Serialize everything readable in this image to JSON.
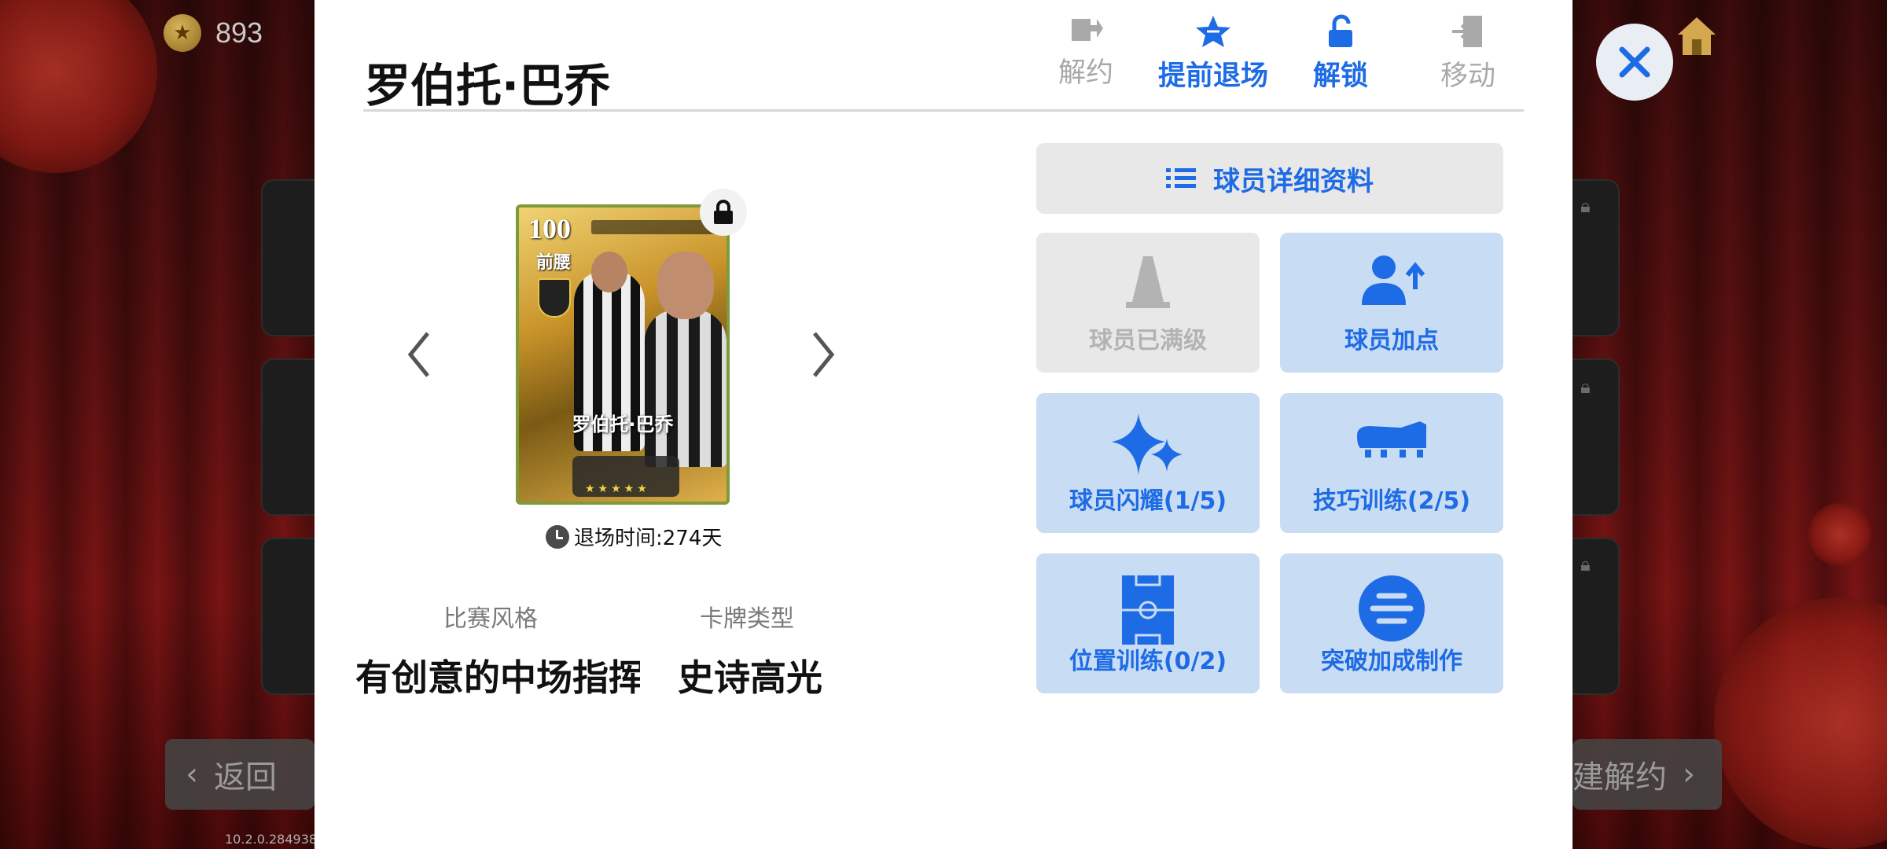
{
  "currency": {
    "amount": "893",
    "icon": "coin-star-icon"
  },
  "background": {
    "back_button_label": "返回",
    "bulk_button_label": "建解约",
    "version": "10.2.0.284938"
  },
  "player": {
    "name": "罗伯托·巴乔",
    "card": {
      "rating": "100",
      "position": "前腰",
      "name": "罗伯托·巴乔"
    },
    "retire_time": "退场时间:274天",
    "play_style_label": "比赛风格",
    "play_style_value": "有创意的中场指挥",
    "card_type_label": "卡牌类型",
    "card_type_value": "史诗高光"
  },
  "top_actions": [
    {
      "label": "解约",
      "icon": "terminate-contract-icon",
      "state": "disabled"
    },
    {
      "label": "提前退场",
      "icon": "early-retire-star-icon",
      "state": "active"
    },
    {
      "label": "解锁",
      "icon": "unlock-icon",
      "state": "active"
    },
    {
      "label": "移动",
      "icon": "move-door-icon",
      "state": "disabled"
    }
  ],
  "detail_button": {
    "label": "球员详细资料",
    "icon": "list-icon"
  },
  "tiles": [
    {
      "label": "球员已满级",
      "icon": "training-cone-icon",
      "state": "off"
    },
    {
      "label": "球员加点",
      "icon": "user-arrow-up-icon",
      "state": "on"
    },
    {
      "label": "球员闪耀(1/5)",
      "icon": "sparkle-icon",
      "state": "on"
    },
    {
      "label": "技巧训练(2/5)",
      "icon": "football-boot-icon",
      "state": "on"
    },
    {
      "label": "位置训练(0/2)",
      "icon": "pitch-icon",
      "state": "on"
    },
    {
      "label": "突破加成制作",
      "icon": "efootball-logo-icon",
      "state": "on"
    }
  ],
  "colors": {
    "accent": "#1e6be6",
    "tile_on": "#c8dcf3",
    "tile_off": "#e8e8e8"
  }
}
